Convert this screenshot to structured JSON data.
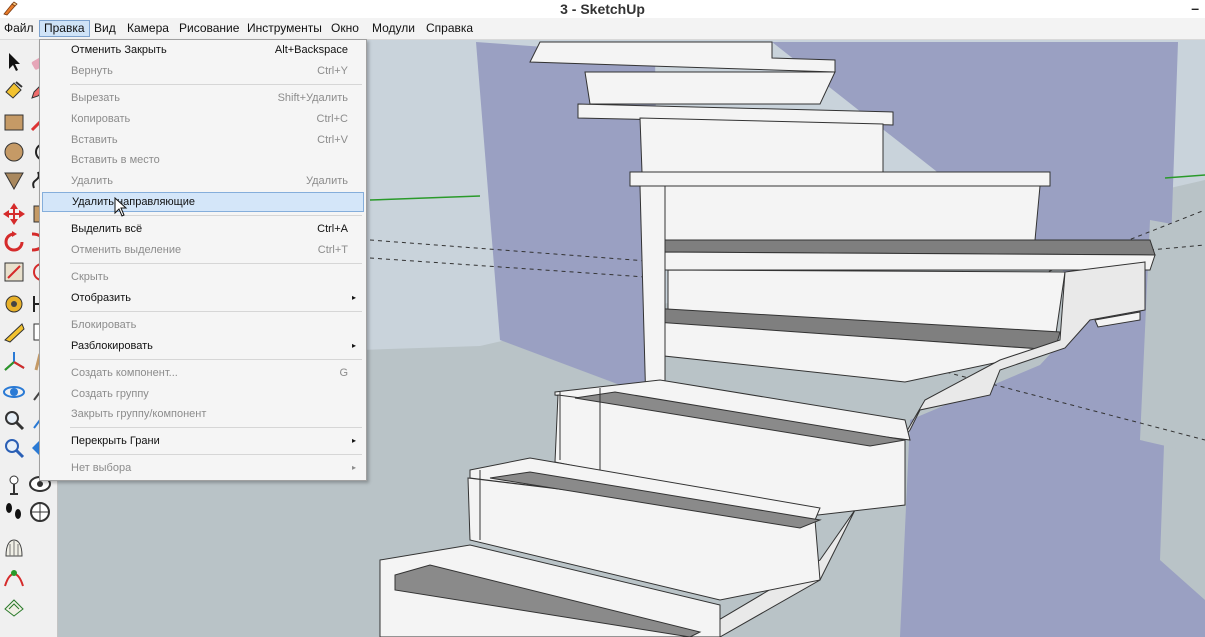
{
  "window": {
    "title": "3 - SketchUp",
    "minimize_glyph": "–"
  },
  "menubar": [
    {
      "label": "Файл",
      "active": false
    },
    {
      "label": "Правка",
      "active": true
    },
    {
      "label": "Вид",
      "active": false
    },
    {
      "label": "Камера",
      "active": false
    },
    {
      "label": "Рисование",
      "active": false
    },
    {
      "label": "Инструменты",
      "active": false
    },
    {
      "label": "Окно",
      "active": false
    },
    {
      "label": "Модули",
      "active": false
    },
    {
      "label": "Справка",
      "active": false
    }
  ],
  "edit_menu": {
    "items": [
      {
        "label": "Отменить Закрыть",
        "shortcut": "Alt+Backspace",
        "enabled": true
      },
      {
        "label": "Вернуть",
        "shortcut": "Ctrl+Y",
        "enabled": false
      },
      {
        "label": "Вырезать",
        "shortcut": "Shift+Удалить",
        "enabled": false
      },
      {
        "label": "Копировать",
        "shortcut": "Ctrl+C",
        "enabled": false
      },
      {
        "label": "Вставить",
        "shortcut": "Ctrl+V",
        "enabled": false
      },
      {
        "label": "Вставить в место",
        "shortcut": "",
        "enabled": false
      },
      {
        "label": "Удалить",
        "shortcut": "Удалить",
        "enabled": false
      },
      {
        "label": "Удалить направляющие",
        "shortcut": "",
        "enabled": true,
        "highlighted": true
      },
      {
        "label": "Выделить всё",
        "shortcut": "Ctrl+A",
        "enabled": true
      },
      {
        "label": "Отменить выделение",
        "shortcut": "Ctrl+T",
        "enabled": false
      },
      {
        "label": "Скрыть",
        "shortcut": "",
        "enabled": false
      },
      {
        "label": "Отобразить",
        "shortcut": "",
        "enabled": true,
        "submenu": true
      },
      {
        "label": "Блокировать",
        "shortcut": "",
        "enabled": false
      },
      {
        "label": "Разблокировать",
        "shortcut": "",
        "enabled": true,
        "submenu": true
      },
      {
        "label": "Создать компонент...",
        "shortcut": "G",
        "enabled": false
      },
      {
        "label": "Создать группу",
        "shortcut": "",
        "enabled": false
      },
      {
        "label": "Закрыть группу/компонент",
        "shortcut": "",
        "enabled": false
      },
      {
        "label": "Перекрыть Грани",
        "shortcut": "",
        "enabled": true,
        "submenu": true
      },
      {
        "label": "Нет выбора",
        "shortcut": "",
        "enabled": false,
        "submenu": true
      }
    ],
    "submenu_arrow": "▸"
  },
  "toolbar_icons": [
    "select-arrow-icon",
    "eraser-icon",
    "paint-bucket-icon",
    "pencil-icon",
    "rectangle-icon",
    "line-icon",
    "circle-icon",
    "arc-icon",
    "polygon-icon",
    "freehand-icon",
    "move-icon",
    "push-pull-icon",
    "rotate-icon",
    "follow-me-icon",
    "scale-icon",
    "offset-icon",
    "tape-measure-icon",
    "dimension-icon",
    "protractor-icon",
    "text-icon",
    "axes-icon",
    "3d-text-icon",
    "orbit-icon",
    "pan-icon",
    "zoom-icon",
    "zoom-window-icon",
    "zoom-extents-icon",
    "previous-view-icon",
    "position-camera-icon",
    "look-around-icon",
    "walk-icon",
    "section-plane-icon",
    "sandbox-icon",
    "smoove-icon",
    "stamp-icon"
  ],
  "colors": {
    "sky": "#c9d3db",
    "ground": "#b9c3c7",
    "wall": "#9aa0c2",
    "stair_face": "#f4f4f4",
    "tread_top": "#7f7f7f",
    "menu_highlight": "#d4e6f9"
  }
}
